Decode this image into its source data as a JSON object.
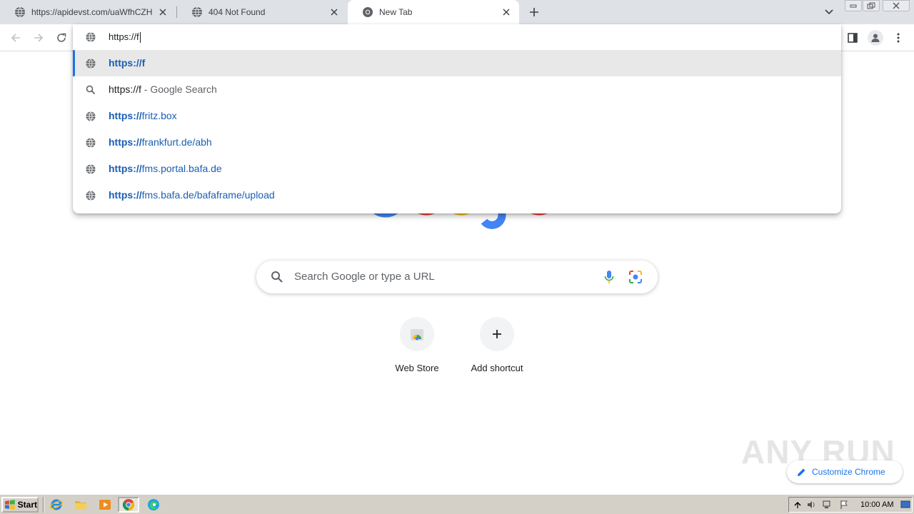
{
  "tabs": [
    {
      "title": "https://apidevst.com/uaWfhCZHOIP",
      "active": false
    },
    {
      "title": "404 Not Found",
      "active": false
    },
    {
      "title": "New Tab",
      "active": true
    }
  ],
  "omnibox": {
    "value": "https://f",
    "suggestions": [
      {
        "type": "url",
        "bold": "https://",
        "rest": "f",
        "boldRest": true,
        "selected": true
      },
      {
        "type": "search",
        "text": "https://f",
        "desc": " - Google Search",
        "selected": false
      },
      {
        "type": "url",
        "bold": "https://",
        "rest": "fritz.box",
        "selected": false
      },
      {
        "type": "url",
        "bold": "https://",
        "rest": "frankfurt.de/abh",
        "selected": false
      },
      {
        "type": "url",
        "bold": "https://",
        "rest": "fms.portal.bafa.de",
        "selected": false
      },
      {
        "type": "url",
        "bold": "https://",
        "rest": "fms.bafa.de/bafaframe/upload",
        "selected": false
      }
    ]
  },
  "ntp": {
    "search_placeholder": "Search Google or type a URL",
    "shortcuts": [
      {
        "label": "Web Store"
      },
      {
        "label": "Add shortcut"
      }
    ],
    "customize_label": "Customize Chrome"
  },
  "watermark": "ANY RUN",
  "taskbar": {
    "start_label": "Start",
    "clock": "10:00 AM"
  },
  "colors": {
    "accent": "#1a73e8",
    "url_text": "#1a5fb4",
    "tabstrip": "#dee1e6",
    "taskbar": "#d4d0c8"
  }
}
